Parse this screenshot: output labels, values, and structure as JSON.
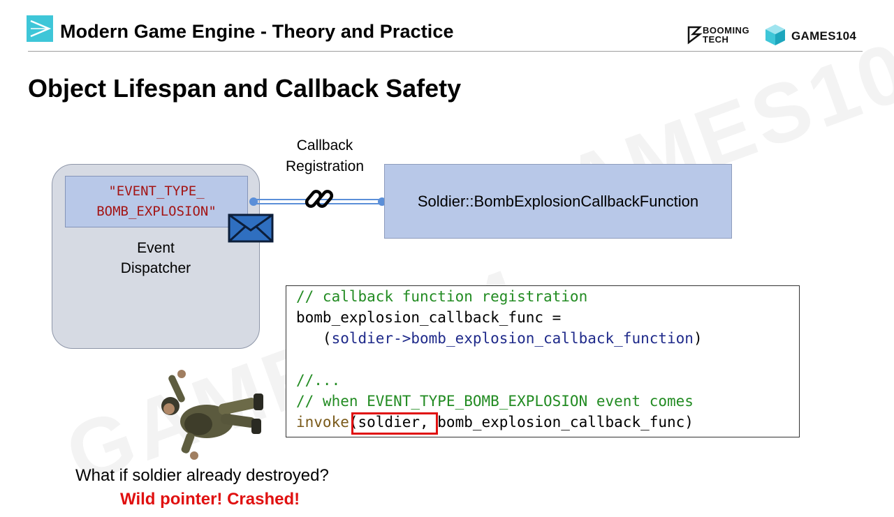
{
  "header": {
    "title": "Modern Game Engine - Theory and Practice",
    "brand_booming_line1": "BOOMING",
    "brand_booming_line2": "TECH",
    "brand_games": "GAMES104"
  },
  "slide": {
    "title": "Object Lifespan and Callback Safety"
  },
  "diagram": {
    "event_type_line1": "\"EVENT_TYPE_",
    "event_type_line2": "BOMB_EXPLOSION\"",
    "dispatcher_line1": "Event",
    "dispatcher_line2": "Dispatcher",
    "callback_label_line1": "Callback",
    "callback_label_line2": "Registration",
    "callback_function": "Soldier::BombExplosionCallbackFunction"
  },
  "code": {
    "line1_comment": "// callback function registration",
    "line2": "bomb_explosion_callback_func =",
    "line3_indent": "   (",
    "line3_blue": "soldier->bomb_explosion_callback_function",
    "line3_close": ")",
    "line5_comment": "//...",
    "line6_comment": "// when EVENT_TYPE_BOMB_EXPLOSION event comes",
    "line7_fn": "invoke",
    "line7_args": "(soldier, bomb_explosion_callback_func)"
  },
  "caption": {
    "question": "What if soldier already destroyed?",
    "warning": "Wild pointer! Crashed!"
  },
  "colors": {
    "accent_cyan": "#3ec6d8",
    "warning_red": "#e01010",
    "comment_green": "#228b22",
    "string_red": "#a31515"
  }
}
